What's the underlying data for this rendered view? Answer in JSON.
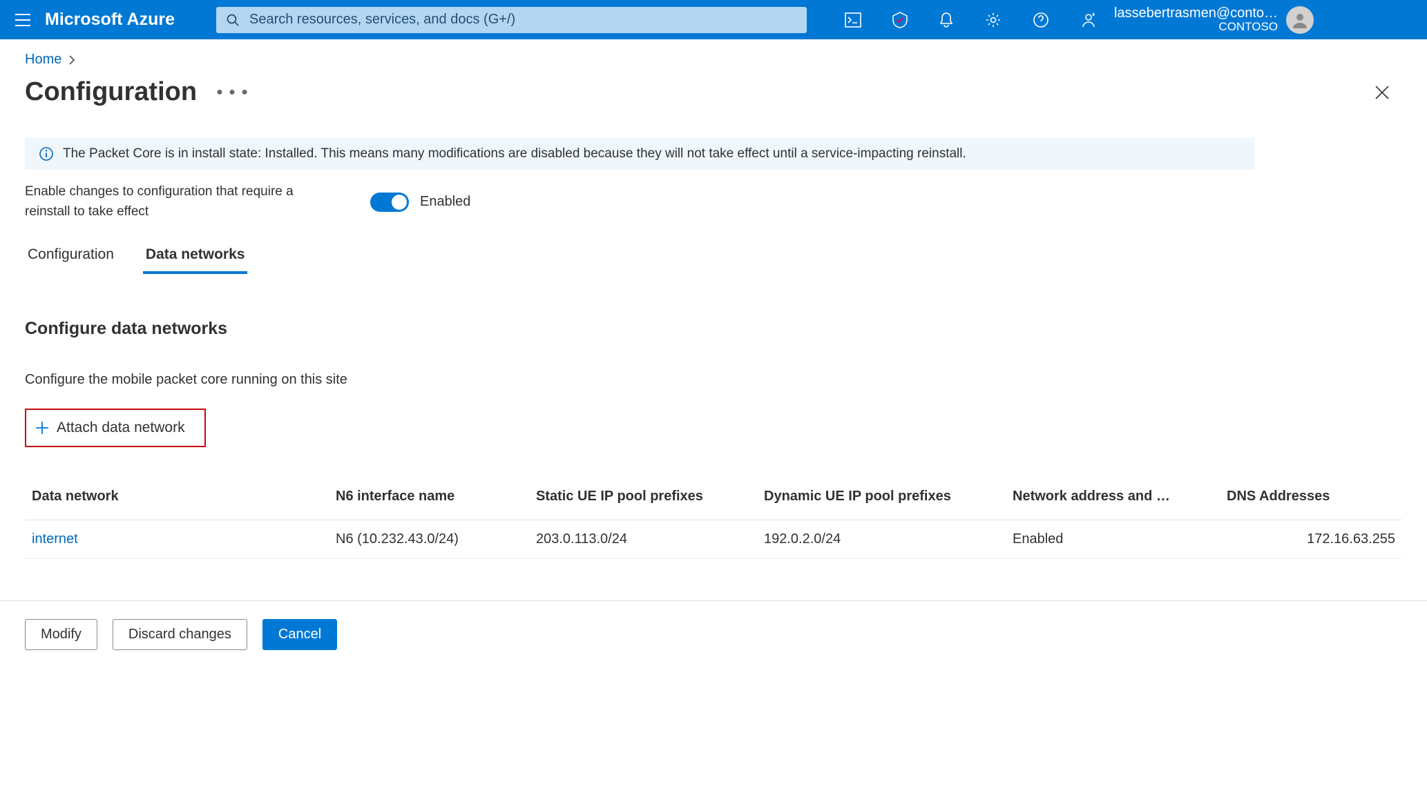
{
  "header": {
    "brand": "Microsoft Azure",
    "search_placeholder": "Search resources, services, and docs (G+/)",
    "user_name": "lassebertrasmen@conto…",
    "tenant": "CONTOSO"
  },
  "breadcrumb": {
    "home": "Home"
  },
  "page_title": "Configuration",
  "info_banner": "The Packet Core is in install state: Installed. This means many modifications are disabled because they will not take effect until a service-impacting reinstall.",
  "enable_row": {
    "text": "Enable changes to configuration that require a reinstall to take effect",
    "toggle_label": "Enabled"
  },
  "tabs": {
    "config": "Configuration",
    "data_networks": "Data networks"
  },
  "section": {
    "title": "Configure data networks",
    "desc": "Configure the mobile packet core running on this site",
    "attach_label": "Attach data network"
  },
  "table": {
    "headers": {
      "data_network": "Data network",
      "n6": "N6 interface name",
      "static_ue": "Static UE IP pool prefixes",
      "dynamic_ue": "Dynamic UE IP pool prefixes",
      "napt": "Network address and …",
      "dns": "DNS Addresses"
    },
    "rows": [
      {
        "data_network": "internet",
        "n6": "N6 (10.232.43.0/24)",
        "static_ue": "203.0.113.0/24",
        "dynamic_ue": "192.0.2.0/24",
        "napt": "Enabled",
        "dns": "172.16.63.255"
      }
    ]
  },
  "footer": {
    "modify": "Modify",
    "discard": "Discard changes",
    "cancel": "Cancel"
  }
}
